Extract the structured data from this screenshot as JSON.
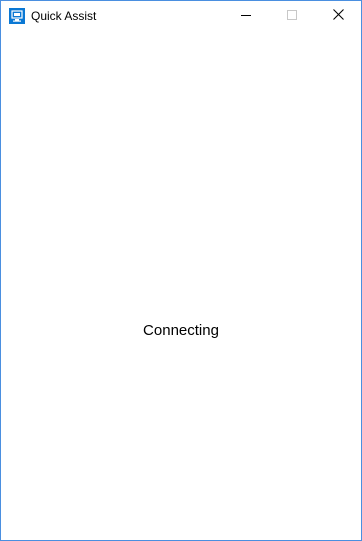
{
  "window": {
    "title": "Quick Assist",
    "icon": "quick-assist-monitor-icon",
    "accent_color": "#4a8fe0",
    "icon_color": "#0a78d4"
  },
  "caption_buttons": {
    "minimize_icon": "minimize-icon",
    "maximize_icon": "maximize-icon",
    "close_icon": "close-icon"
  },
  "main": {
    "status": "Connecting"
  }
}
